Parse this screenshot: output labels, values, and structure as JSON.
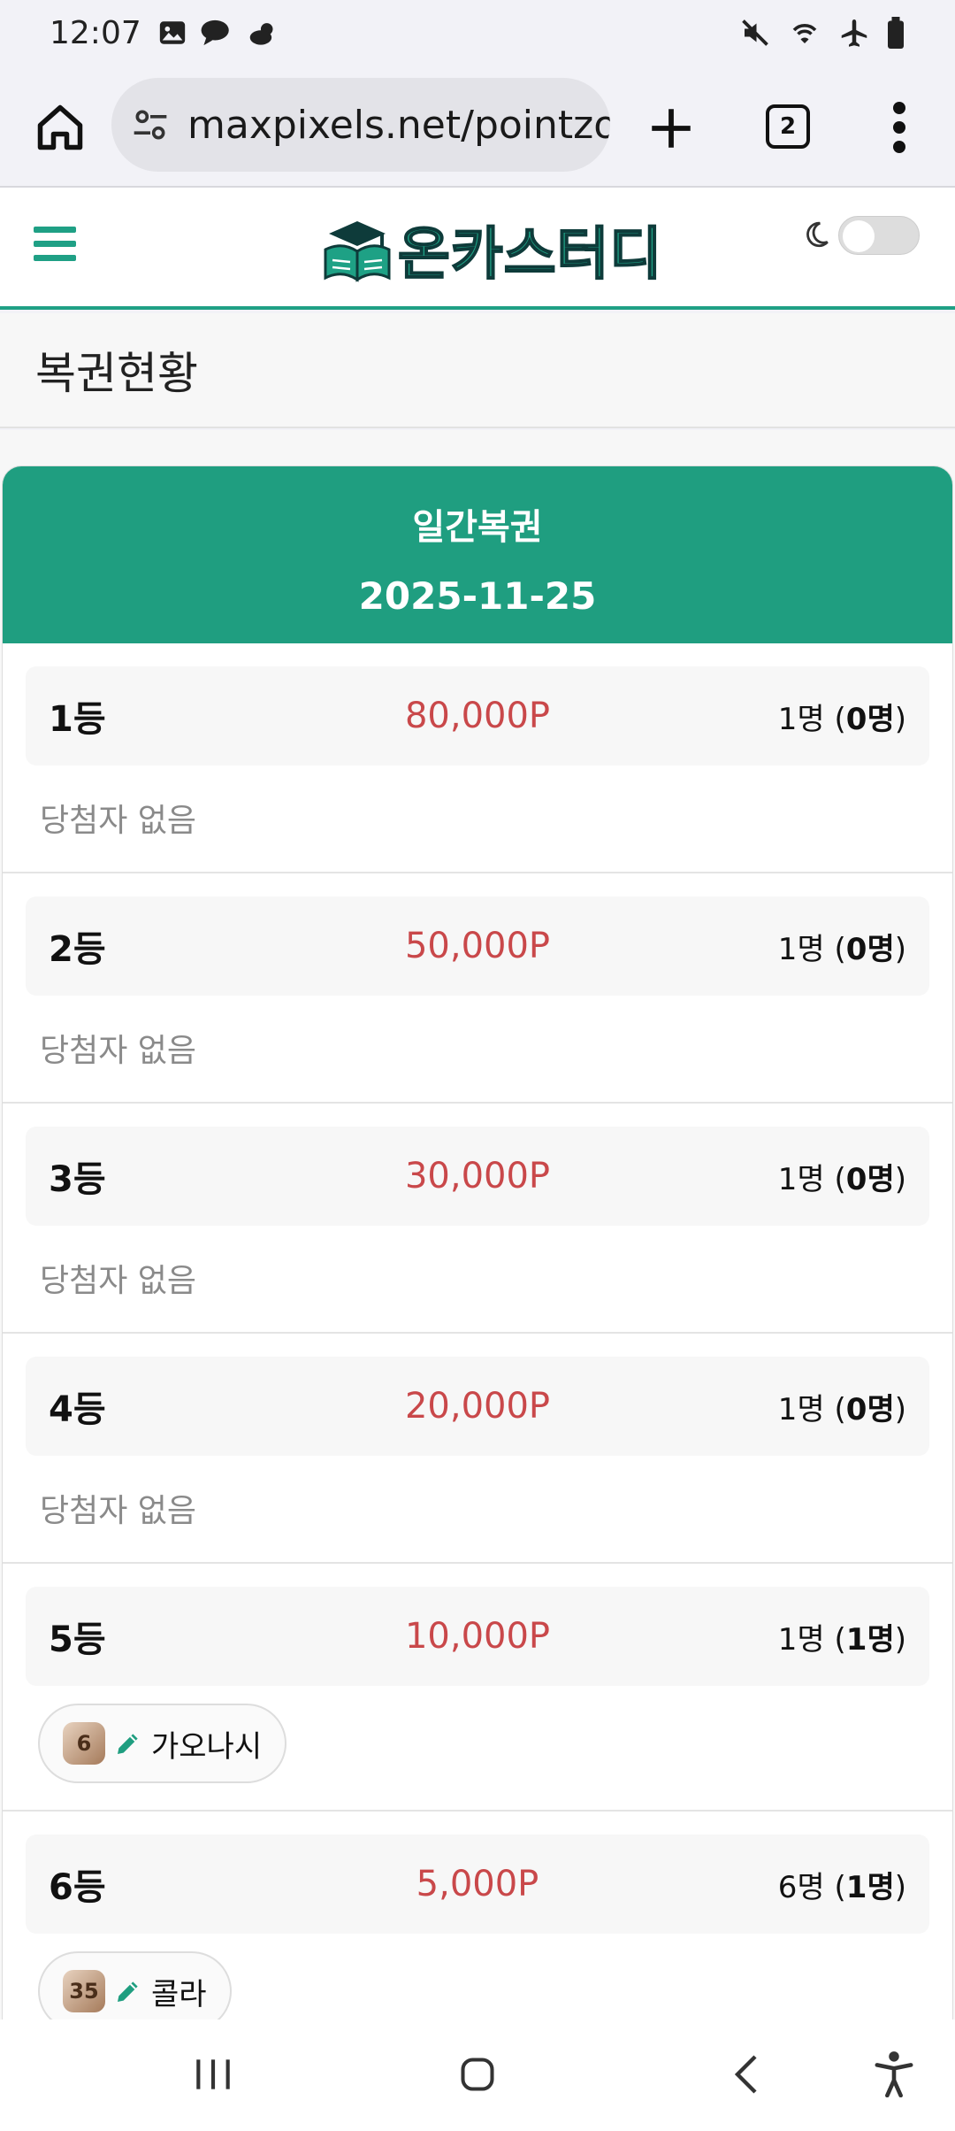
{
  "status": {
    "time": "12:07"
  },
  "browser": {
    "url": "maxpixels.net/pointzone",
    "tab_count": "2"
  },
  "site": {
    "logo_text": "온카스터디"
  },
  "page": {
    "title": "복권현황"
  },
  "lottery": {
    "type_label": "일간복권",
    "date": "2025-11-25",
    "no_winner_text": "당첨자 없음",
    "ranks": [
      {
        "rank": "1등",
        "prize": "80,000P",
        "slots": "1명",
        "winners": "0명"
      },
      {
        "rank": "2등",
        "prize": "50,000P",
        "slots": "1명",
        "winners": "0명"
      },
      {
        "rank": "3등",
        "prize": "30,000P",
        "slots": "1명",
        "winners": "0명"
      },
      {
        "rank": "4등",
        "prize": "20,000P",
        "slots": "1명",
        "winners": "0명"
      },
      {
        "rank": "5등",
        "prize": "10,000P",
        "slots": "1명",
        "winners": "1명",
        "winner": {
          "level": "6",
          "name": "가오나시"
        }
      },
      {
        "rank": "6등",
        "prize": "5,000P",
        "slots": "6명",
        "winners": "1명",
        "winner": {
          "level": "35",
          "name": "콜라"
        }
      }
    ]
  },
  "colors": {
    "accent": "#1f9e80",
    "prize": "#c9484a"
  }
}
